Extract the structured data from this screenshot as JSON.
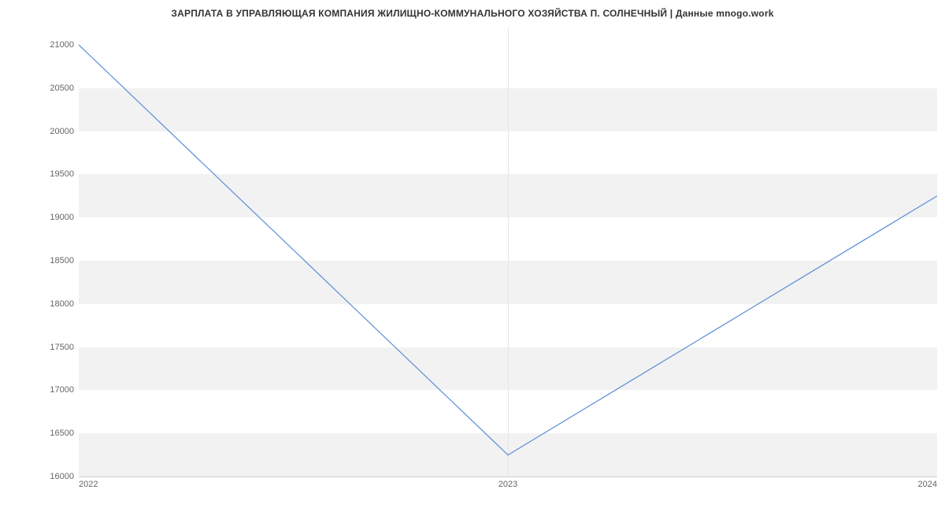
{
  "title": "ЗАРПЛАТА В  УПРАВЛЯЮЩАЯ КОМПАНИЯ ЖИЛИЩНО-КОММУНАЛЬНОГО ХОЗЯЙСТВА П. СОЛНЕЧНЫЙ | Данные mnogo.work",
  "chart_data": {
    "type": "line",
    "title": "ЗАРПЛАТА В  УПРАВЛЯЮЩАЯ КОМПАНИЯ ЖИЛИЩНО-КОММУНАЛЬНОГО ХОЗЯЙСТВА П. СОЛНЕЧНЫЙ | Данные mnogo.work",
    "xlabel": "",
    "ylabel": "",
    "x": [
      "2022",
      "2023",
      "2024"
    ],
    "values": [
      21000,
      16250,
      19250
    ],
    "ylim": [
      16000,
      21200
    ],
    "y_ticks": [
      16000,
      16500,
      17000,
      17500,
      18000,
      18500,
      19000,
      19500,
      20000,
      20500,
      21000
    ],
    "x_ticks": [
      "2022",
      "2023",
      "2024"
    ],
    "line_color": "#5b8fd6",
    "grid": true
  }
}
